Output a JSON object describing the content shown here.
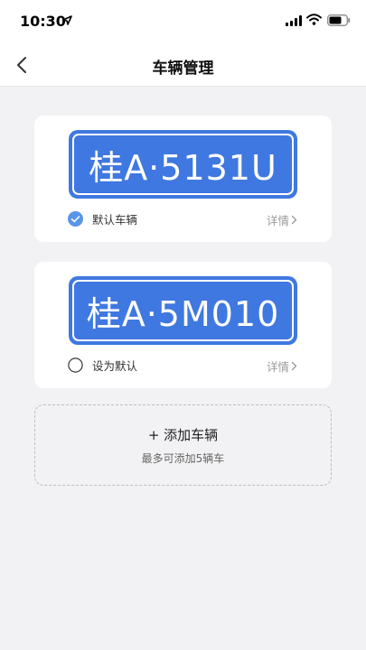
{
  "status_bar": {
    "time": "10:30",
    "icons": [
      "location-arrow-icon",
      "signal-icon",
      "wifi-icon",
      "battery-icon"
    ]
  },
  "nav": {
    "title": "车辆管理",
    "back_icon": "chevron-left-icon"
  },
  "vehicles": [
    {
      "plate": "桂A·5131U",
      "status_label": "默认车辆",
      "is_default": true,
      "detail_label": "详情"
    },
    {
      "plate": "桂A·5M010",
      "status_label": "设为默认",
      "is_default": false,
      "detail_label": "详情"
    }
  ],
  "add_vehicle": {
    "label": "+ 添加车辆",
    "hint": "最多可添加5辆车"
  },
  "colors": {
    "plate_blue": "#3f78e0",
    "check_blue": "#5a96e8",
    "background": "#f2f2f4"
  }
}
